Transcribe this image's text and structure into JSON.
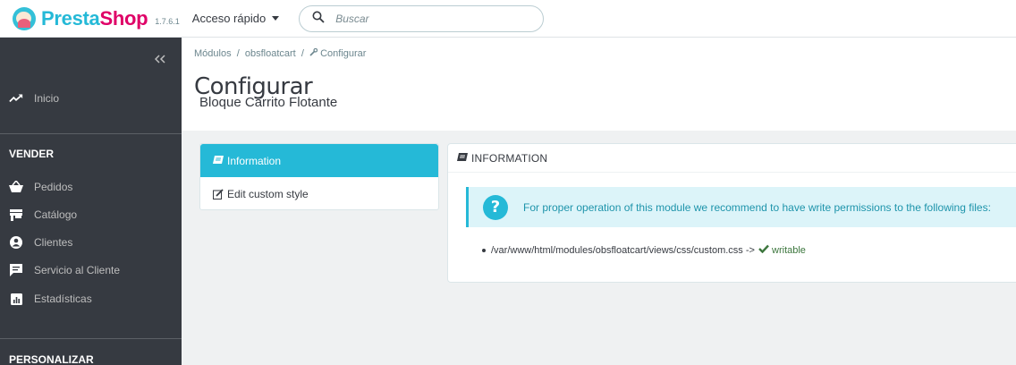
{
  "header": {
    "logo_presta": "Presta",
    "logo_shop": "Shop",
    "version": "1.7.6.1",
    "quick_access": "Acceso rápido",
    "search_placeholder": "Buscar"
  },
  "sidebar": {
    "inicio": "Inicio",
    "section_sell": "VENDER",
    "items": [
      {
        "label": "Pedidos",
        "icon": "shopping-basket-icon"
      },
      {
        "label": "Catálogo",
        "icon": "store-icon"
      },
      {
        "label": "Clientes",
        "icon": "account-circle-icon"
      },
      {
        "label": "Servicio al Cliente",
        "icon": "chat-icon"
      },
      {
        "label": "Estadísticas",
        "icon": "chart-icon"
      }
    ],
    "section_customize": "PERSONALIZAR"
  },
  "page": {
    "breadcrumb": [
      "Módulos",
      "obsfloatcart",
      "Configurar"
    ],
    "title": "Configurar",
    "subtitle": "Bloque Carrito Flotante"
  },
  "tabs": [
    {
      "label": "Information",
      "active": true
    },
    {
      "label": "Edit custom style",
      "active": false
    }
  ],
  "panel": {
    "title": "INFORMATION",
    "alert": "For proper operation of this module we recommend to have write permissions to the following files:",
    "file_path": "/var/www/html/modules/obsfloatcart/views/css/custom.css ->",
    "file_status": "writable"
  },
  "colors": {
    "accent": "#25b9d7",
    "brand_pink": "#df0067",
    "sidebar_bg": "#363a41",
    "success": "#3c763d"
  }
}
